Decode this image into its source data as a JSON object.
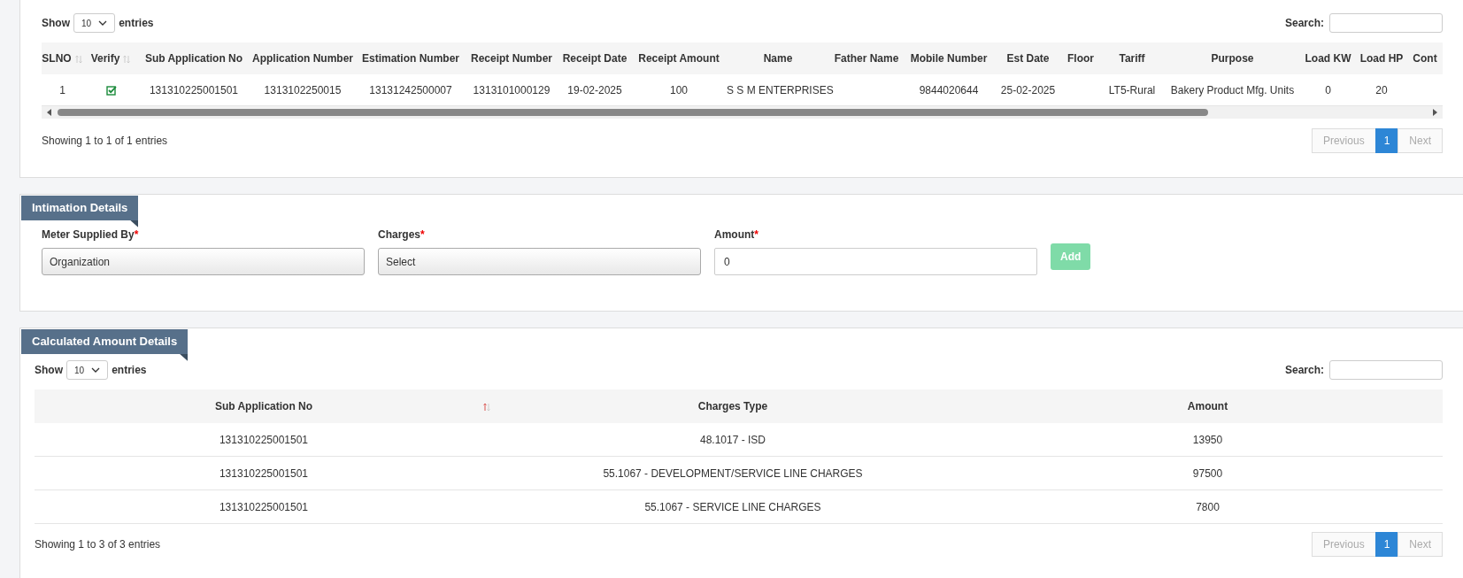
{
  "applications": {
    "length_label_before": "Show",
    "length_value": "10",
    "length_label_after": "entries",
    "search_label": "Search:",
    "columns": [
      {
        "label": "SLNO",
        "sortable": true,
        "sort_ascending": false
      },
      {
        "label": "Verify",
        "sortable": true,
        "sort_ascending": false
      },
      {
        "label": "Sub Application No"
      },
      {
        "label": "Application Number"
      },
      {
        "label": "Estimation Number"
      },
      {
        "label": "Receipt Number"
      },
      {
        "label": "Receipt Date"
      },
      {
        "label": "Receipt Amount"
      },
      {
        "label": "Name"
      },
      {
        "label": "Father Name"
      },
      {
        "label": "Mobile Number"
      },
      {
        "label": "Est Date"
      },
      {
        "label": "Floor"
      },
      {
        "label": "Tariff"
      },
      {
        "label": "Purpose"
      },
      {
        "label": "Load KW"
      },
      {
        "label": "Load HP"
      },
      {
        "label": "Cont"
      }
    ],
    "rows": [
      {
        "verified": true,
        "cells": [
          "1",
          "",
          "131310225001501",
          "1313102250015",
          "13131242500007",
          "1313101000129",
          "19-02-2025",
          "100",
          "S S M ENTERPRISES",
          "",
          "9844020644",
          "25-02-2025",
          "",
          "LT5-Rural",
          "Bakery Product Mfg. Units",
          "0",
          "20",
          ""
        ]
      }
    ],
    "info": "Showing 1 to 1 of 1 entries",
    "pagination": {
      "previous": {
        "label": "Previous",
        "disabled": true
      },
      "pages": [
        {
          "label": "1",
          "selected": true
        }
      ],
      "next": {
        "label": "Next",
        "disabled": true
      }
    }
  },
  "intimation": {
    "title": "Intimation Details",
    "fields": [
      {
        "kind": "select",
        "label": "Meter Supplied By",
        "required_mark": "*",
        "value": "Organization"
      },
      {
        "kind": "select",
        "label": "Charges",
        "required_mark": "*",
        "value": "Select"
      },
      {
        "kind": "input",
        "label": "Amount",
        "required_mark": "*",
        "value": "0"
      }
    ],
    "add_button": {
      "label": "Add",
      "disabled": true
    }
  },
  "calculated": {
    "title": "Calculated Amount Details",
    "length_label_before": "Show",
    "length_value": "10",
    "length_label_after": "entries",
    "search_label": "Search:",
    "columns": [
      {
        "label": "Sub Application No",
        "sortable": true,
        "sort_ascending": true
      },
      {
        "label": "Charges Type"
      },
      {
        "label": "Amount"
      }
    ],
    "rows": [
      [
        "131310225001501",
        "48.1017 - ISD",
        "13950"
      ],
      [
        "131310225001501",
        "55.1067 - DEVELOPMENT/SERVICE LINE CHARGES",
        "97500"
      ],
      [
        "131310225001501",
        "55.1067 - SERVICE LINE CHARGES",
        "7800"
      ]
    ],
    "info": "Showing 1 to 3 of 3 entries",
    "pagination": {
      "previous": {
        "label": "Previous",
        "disabled": true
      },
      "pages": [
        {
          "label": "1",
          "selected": true
        }
      ],
      "next": {
        "label": "Next",
        "disabled": true
      }
    }
  }
}
